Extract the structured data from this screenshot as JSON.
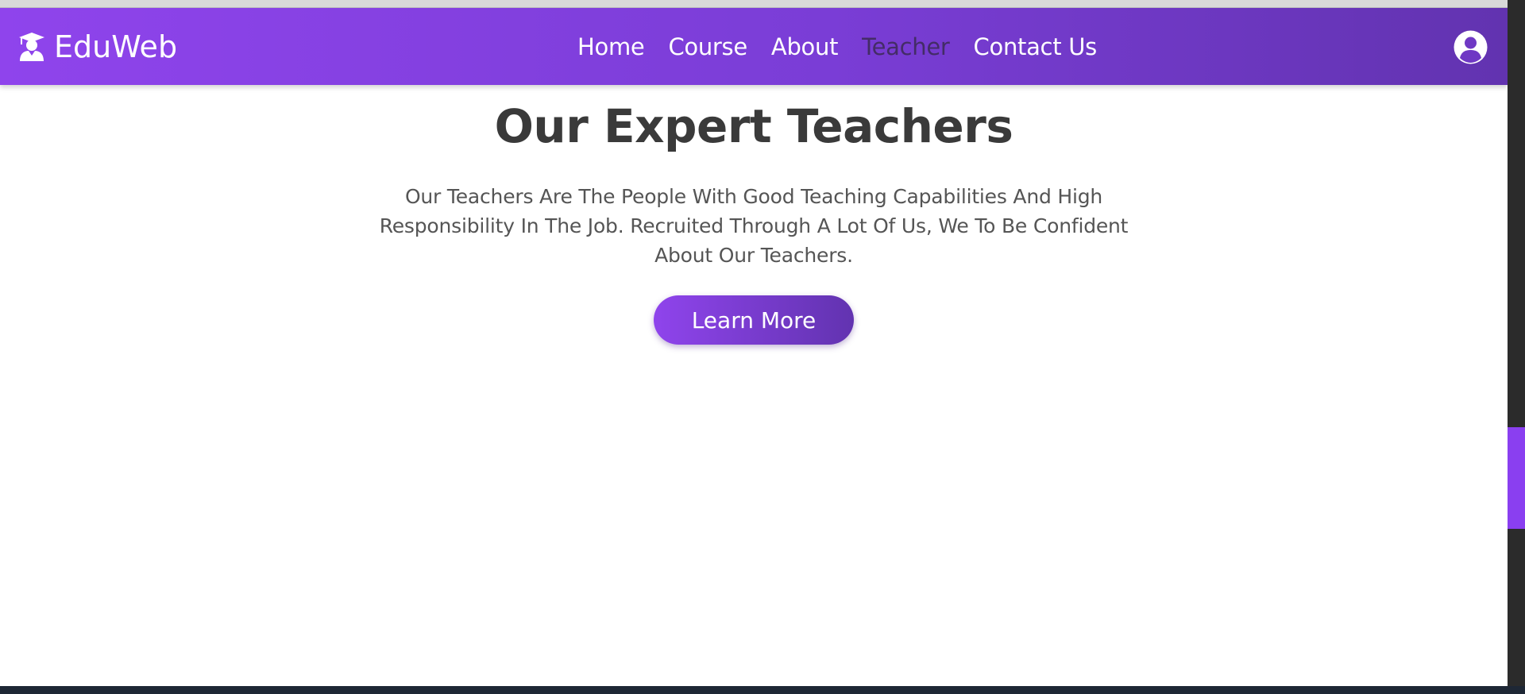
{
  "brand": {
    "name": "EduWeb",
    "logo_icon": "teacher-graduation-cap-icon"
  },
  "nav": {
    "items": [
      {
        "label": "Home",
        "active": false
      },
      {
        "label": "Course",
        "active": false
      },
      {
        "label": "About",
        "active": false
      },
      {
        "label": "Teacher",
        "active": true
      },
      {
        "label": "Contact Us",
        "active": false
      }
    ],
    "profile_icon": "user-circle-icon"
  },
  "hero": {
    "title": "Our Expert Teachers",
    "text": "Our Teachers Are The People With Good Teaching Capabilities And High Responsibility In The Job. Recruited Through A Lot Of Us, We To Be Confident About Our Teachers.",
    "button_label": "Learn More"
  },
  "colors": {
    "gradient_start": "#8f44ec",
    "gradient_end": "#6233b0",
    "active_nav": "#3b2a55",
    "title": "#3a3a3a",
    "body_text": "#555555"
  }
}
